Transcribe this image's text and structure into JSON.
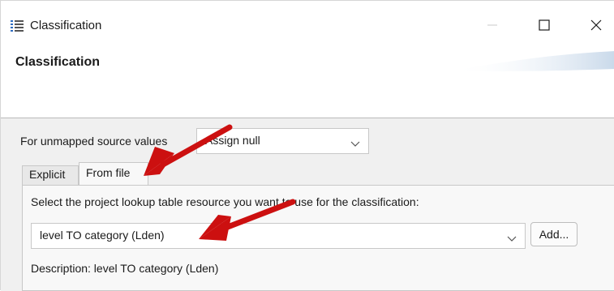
{
  "window": {
    "title": "Classification",
    "minimize_icon": "minimize-icon",
    "maximize_icon": "maximize-icon",
    "close_icon": "close-icon"
  },
  "banner": {
    "title": "Classification"
  },
  "unmapped": {
    "label": "For unmapped source values",
    "selected": "Assign null"
  },
  "tabs": [
    {
      "label": "Explicit",
      "active": false
    },
    {
      "label": "From file",
      "active": true
    }
  ],
  "panel": {
    "select_label": "Select the project lookup table resource you want to use for the classification:",
    "lookup_selected": "level TO category (Lden)",
    "add_label": "Add...",
    "description": "Description: level TO category (Lden)"
  },
  "colors": {
    "arrow": "#cc1010",
    "panel_bg": "#f8f8f8",
    "body_bg": "#f0f0f0"
  }
}
